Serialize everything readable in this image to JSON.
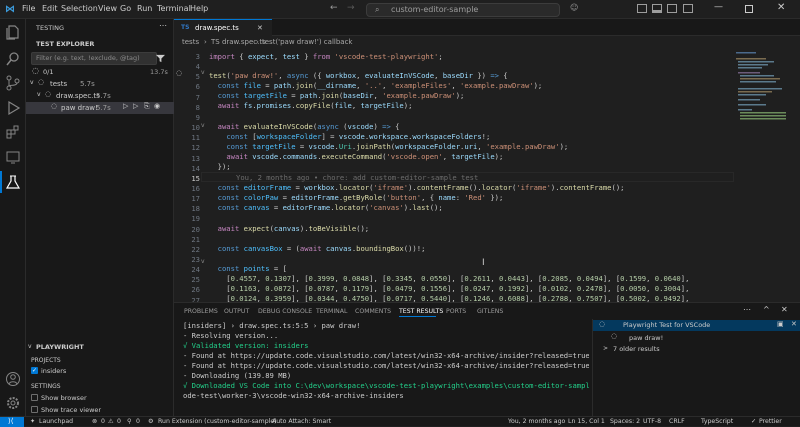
{
  "titlebar": {
    "menus": [
      "File",
      "Edit",
      "Selection",
      "View",
      "Go",
      "Run",
      "Terminal",
      "Help"
    ],
    "search": "custom-editor-sample"
  },
  "sidebar": {
    "title": "TESTING",
    "explorer": "TEST EXPLORER",
    "filter_placeholder": "Filter (e.g. text, !exclude, @tag)",
    "summary": "0/1",
    "summary_time": "13.7s",
    "tree": [
      {
        "label": "tests",
        "time": "5.7s"
      },
      {
        "label": "draw.spec.ts",
        "time": "5.7s"
      },
      {
        "label": "paw draw!",
        "time": "5.7s"
      }
    ],
    "playwright": "PLAYWRIGHT",
    "projects": "PROJECTS",
    "insiders": "insiders",
    "settings": "SETTINGS",
    "show_browser": "Show browser",
    "show_trace": "Show trace viewer"
  },
  "editor": {
    "tab": "draw.spec.ts",
    "tab_icon": "TS",
    "breadcrumb": [
      "tests",
      "TS draw.spec.ts",
      "test('paw draw!') callback"
    ],
    "line_numbers": [
      "3",
      "4",
      "5",
      "6",
      "7",
      "8",
      "9",
      "10",
      "11",
      "12",
      "13",
      "14",
      "15",
      "16",
      "17",
      "18",
      "19",
      "20",
      "21",
      "22",
      "23",
      "24",
      "25",
      "26",
      "27",
      "28"
    ],
    "blame": "You, 2 months ago • chore: add custom-editor-sample test"
  },
  "panel": {
    "tabs": [
      "PROBLEMS",
      "OUTPUT",
      "DEBUG CONSOLE",
      "TERMINAL",
      "COMMENTS",
      "TEST RESULTS",
      "PORTS",
      "GITLENS"
    ],
    "lines": [
      "[insiders] › draw.spec.ts:5:5 › paw draw!",
      "- Resolving version...",
      "√ Validated version: insiders",
      "- Found at https://update.code.visualstudio.com/latest/win32-x64-archive/insider?released=true",
      "- Found at https://update.code.visualstudio.com/latest/win32-x64-archive/insider?released=true",
      "- Downloading (139.89 MB)",
      "√ Downloaded VS Code into C:\\dev\\workspace\\vscode-test-playwright\\examples\\custom-editor-sample\\.vsc",
      "ode-test\\worker-3\\vscode-win32-x64-archive-insiders"
    ],
    "results_title": "Playwright Test for VSCode",
    "results_item": "paw draw!",
    "older": "7 older results"
  },
  "status": {
    "branch": "Launchpad",
    "errors": "0",
    "warnings": "0",
    "ports": "0",
    "run": "Run Extension (custom-editor-sample)",
    "autoattach": "Auto Attach: Smart",
    "blame": "You, 2 months ago",
    "pos": "Ln 15, Col 1",
    "spaces": "Spaces: 2",
    "enc": "UTF-8",
    "eol": "CRLF",
    "lang": "TypeScript",
    "prettier": "Prettier"
  }
}
